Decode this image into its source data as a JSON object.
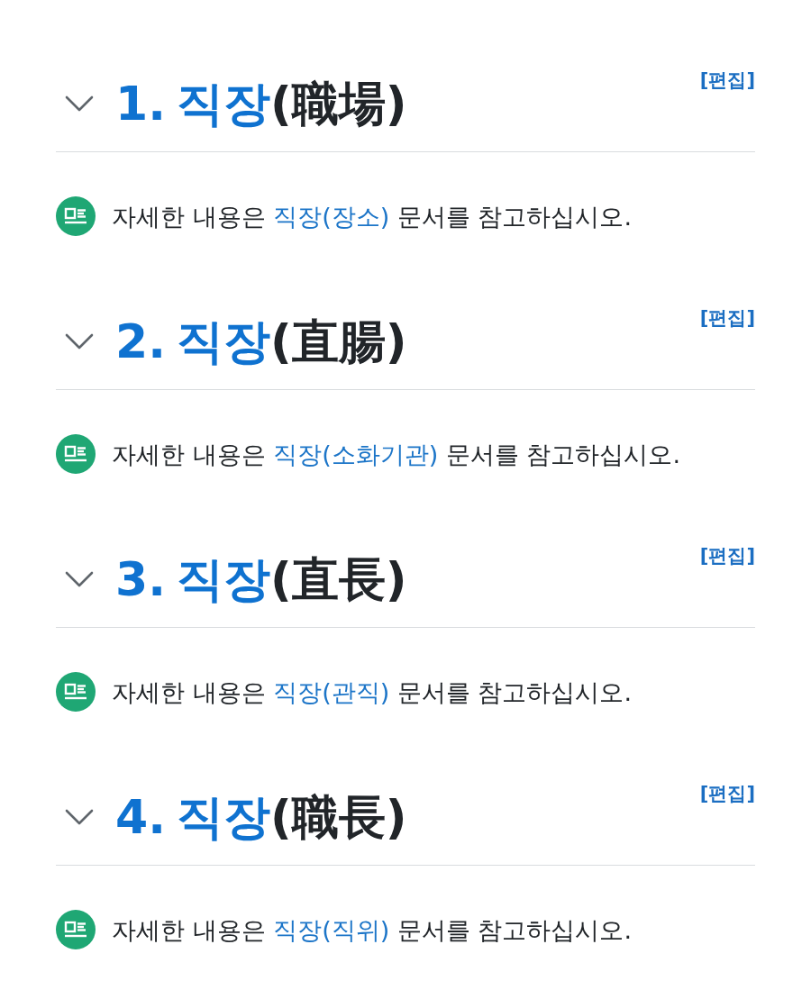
{
  "sections": [
    {
      "expanded": true,
      "number": "1.",
      "title_link": "직장",
      "title_rest": "(職場)",
      "edit": "[편집]",
      "note": {
        "before": "자세한 내용은",
        "link": "직장(장소)",
        "after": "문서를 참고하십시오."
      }
    },
    {
      "expanded": true,
      "number": "2.",
      "title_link": "직장",
      "title_rest": "(直腸)",
      "edit": "[편집]",
      "note": {
        "before": "자세한 내용은",
        "link": "직장(소화기관)",
        "after": "문서를 참고하십시오."
      }
    },
    {
      "expanded": true,
      "number": "3.",
      "title_link": "직장",
      "title_rest": "(直長)",
      "edit": "[편집]",
      "note": {
        "before": "자세한 내용은",
        "link": "직장(관직)",
        "after": "문서를 참고하십시오."
      }
    },
    {
      "expanded": true,
      "number": "4.",
      "title_link": "직장",
      "title_rest": "(職長)",
      "edit": "[편집]",
      "note": {
        "before": "자세한 내용은",
        "link": "직장(직위)",
        "after": "문서를 참고하십시오."
      }
    }
  ]
}
